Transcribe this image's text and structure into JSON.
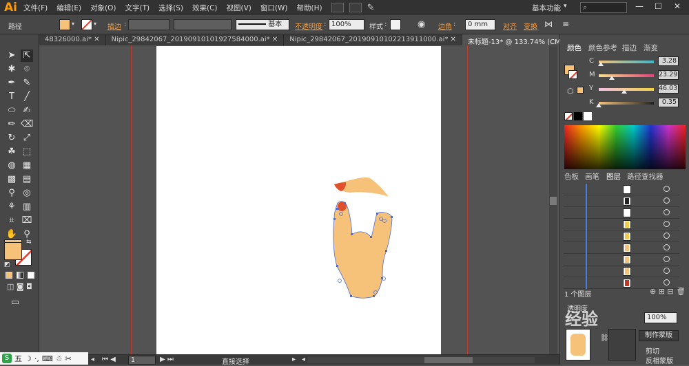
{
  "app": {
    "logo": "Ai",
    "workspace": "基本功能"
  },
  "menu": [
    "文件(F)",
    "编辑(E)",
    "对象(O)",
    "文字(T)",
    "选择(S)",
    "效果(C)",
    "视图(V)",
    "窗口(W)",
    "帮助(H)"
  ],
  "control": {
    "selection_type": "路径",
    "stroke_label": "描边",
    "basic_label": "基本",
    "opacity_label": "不透明度",
    "opacity_value": "100%",
    "style_label": "样式",
    "corner_label": "边角",
    "corner_value": "0 mm",
    "align_link": "对齐",
    "transform_link": "变换",
    "fill_color": "#f6c27a"
  },
  "tabs": [
    {
      "label": "48326000.ai*",
      "active": false
    },
    {
      "label": "Nipic_29842067_20190910101927584000.ai*",
      "active": false
    },
    {
      "label": "Nipic_29842067_20190910102213911000.ai*",
      "active": false
    },
    {
      "label": "未标题-13* @ 133.74% (CMYK/预览)",
      "active": true
    }
  ],
  "color_panel": {
    "tabs": [
      "颜色",
      "颜色参考",
      "描边",
      "渐变"
    ],
    "channels": [
      {
        "name": "C",
        "value": "3.28",
        "unit": "%",
        "fraction": 0.0328,
        "grad": "linear-gradient(90deg,#f6c27a,#3fb8c9)"
      },
      {
        "name": "M",
        "value": "23.29",
        "unit": "%",
        "fraction": 0.2329,
        "grad": "linear-gradient(90deg,#f7e08a,#e0457b)"
      },
      {
        "name": "Y",
        "value": "46.03",
        "unit": "%",
        "fraction": 0.4603,
        "grad": "linear-gradient(90deg,#f6c0e6,#f2d23c)"
      },
      {
        "name": "K",
        "value": "0.35",
        "unit": "%",
        "fraction": 0.0035,
        "grad": "linear-gradient(90deg,#f6c27a,#222)"
      }
    ]
  },
  "layers_panel": {
    "tabs": [
      "色板",
      "画笔",
      "图层",
      "路径查找器"
    ],
    "footer_label": "1 个图层",
    "rows": 9
  },
  "transparency": {
    "opacity_value": "100%",
    "mask_button": "制作蒙版",
    "clip_label": "剪切",
    "invert_label": "反相蒙版"
  },
  "status": {
    "zoom": "133.74",
    "artboard": "1",
    "tool_label": "直接选择"
  },
  "ime": {
    "brand": "五"
  },
  "watermark": "经验"
}
